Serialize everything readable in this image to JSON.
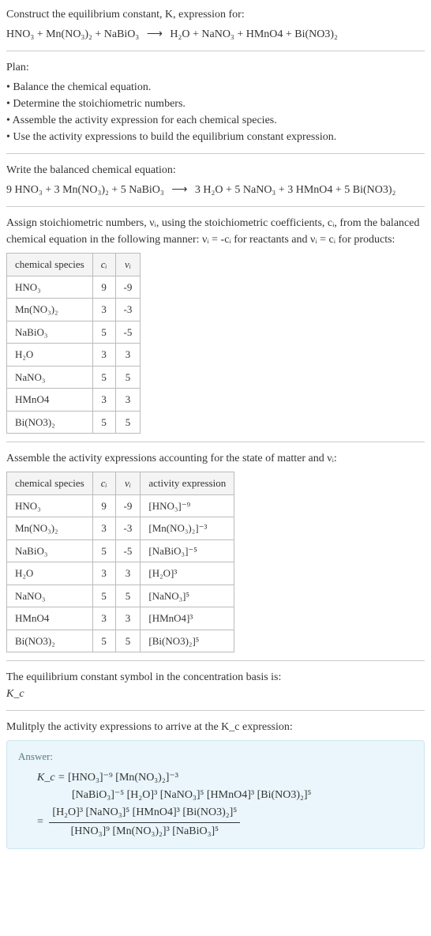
{
  "prompt": {
    "line1": "Construct the equilibrium constant, K, expression for:",
    "equation_lhs": "HNO₃ + Mn(NO₃)₂ + NaBiO₃",
    "arrow": "⟶",
    "equation_rhs": "H₂O + NaNO₃ + HMnO4 + Bi(NO3)₂"
  },
  "plan": {
    "header": "Plan:",
    "items": [
      "Balance the chemical equation.",
      "Determine the stoichiometric numbers.",
      "Assemble the activity expression for each chemical species.",
      "Use the activity expressions to build the equilibrium constant expression."
    ]
  },
  "balanced": {
    "header": "Write the balanced chemical equation:",
    "lhs": "9 HNO₃ + 3 Mn(NO₃)₂ + 5 NaBiO₃",
    "arrow": "⟶",
    "rhs": "3 H₂O + 5 NaNO₃ + 3 HMnO4 + 5 Bi(NO3)₂"
  },
  "stoich_text": "Assign stoichiometric numbers, νᵢ, using the stoichiometric coefficients, cᵢ, from the balanced chemical equation in the following manner: νᵢ = -cᵢ for reactants and νᵢ = cᵢ for products:",
  "table1": {
    "headers": [
      "chemical species",
      "cᵢ",
      "νᵢ"
    ],
    "rows": [
      [
        "HNO₃",
        "9",
        "-9"
      ],
      [
        "Mn(NO₃)₂",
        "3",
        "-3"
      ],
      [
        "NaBiO₃",
        "5",
        "-5"
      ],
      [
        "H₂O",
        "3",
        "3"
      ],
      [
        "NaNO₃",
        "5",
        "5"
      ],
      [
        "HMnO4",
        "3",
        "3"
      ],
      [
        "Bi(NO3)₂",
        "5",
        "5"
      ]
    ]
  },
  "activity_text": "Assemble the activity expressions accounting for the state of matter and νᵢ:",
  "table2": {
    "headers": [
      "chemical species",
      "cᵢ",
      "νᵢ",
      "activity expression"
    ],
    "rows": [
      [
        "HNO₃",
        "9",
        "-9",
        "[HNO₃]⁻⁹"
      ],
      [
        "Mn(NO₃)₂",
        "3",
        "-3",
        "[Mn(NO₃)₂]⁻³"
      ],
      [
        "NaBiO₃",
        "5",
        "-5",
        "[NaBiO₃]⁻⁵"
      ],
      [
        "H₂O",
        "3",
        "3",
        "[H₂O]³"
      ],
      [
        "NaNO₃",
        "5",
        "5",
        "[NaNO₃]⁵"
      ],
      [
        "HMnO4",
        "3",
        "3",
        "[HMnO4]³"
      ],
      [
        "Bi(NO3)₂",
        "5",
        "5",
        "[Bi(NO3)₂]⁵"
      ]
    ]
  },
  "eq_symbol": {
    "line1": "The equilibrium constant symbol in the concentration basis is:",
    "line2": "K_c"
  },
  "multiply_text": "Mulitply the activity expressions to arrive at the K_c expression:",
  "answer": {
    "label": "Answer:",
    "line1_left": "K_c = ",
    "line1_right": "[HNO₃]⁻⁹ [Mn(NO₃)₂]⁻³",
    "line2": "[NaBiO₃]⁻⁵ [H₂O]³ [NaNO₃]⁵ [HMnO4]³ [Bi(NO3)₂]⁵",
    "frac_num": "[H₂O]³ [NaNO₃]⁵ [HMnO4]³ [Bi(NO3)₂]⁵",
    "frac_den": "[HNO₃]⁹ [Mn(NO₃)₂]³ [NaBiO₃]⁵",
    "equals": " = "
  },
  "chart_data": {
    "type": "table",
    "tables": [
      {
        "title": "Stoichiometric numbers",
        "columns": [
          "chemical species",
          "c_i",
          "ν_i"
        ],
        "rows": [
          {
            "species": "HNO3",
            "c_i": 9,
            "nu_i": -9
          },
          {
            "species": "Mn(NO3)2",
            "c_i": 3,
            "nu_i": -3
          },
          {
            "species": "NaBiO3",
            "c_i": 5,
            "nu_i": -5
          },
          {
            "species": "H2O",
            "c_i": 3,
            "nu_i": 3
          },
          {
            "species": "NaNO3",
            "c_i": 5,
            "nu_i": 5
          },
          {
            "species": "HMnO4",
            "c_i": 3,
            "nu_i": 3
          },
          {
            "species": "Bi(NO3)2",
            "c_i": 5,
            "nu_i": 5
          }
        ]
      },
      {
        "title": "Activity expressions",
        "columns": [
          "chemical species",
          "c_i",
          "ν_i",
          "activity expression"
        ],
        "rows": [
          {
            "species": "HNO3",
            "c_i": 9,
            "nu_i": -9,
            "activity": "[HNO3]^-9"
          },
          {
            "species": "Mn(NO3)2",
            "c_i": 3,
            "nu_i": -3,
            "activity": "[Mn(NO3)2]^-3"
          },
          {
            "species": "NaBiO3",
            "c_i": 5,
            "nu_i": -5,
            "activity": "[NaBiO3]^-5"
          },
          {
            "species": "H2O",
            "c_i": 3,
            "nu_i": 3,
            "activity": "[H2O]^3"
          },
          {
            "species": "NaNO3",
            "c_i": 5,
            "nu_i": 5,
            "activity": "[NaNO3]^5"
          },
          {
            "species": "HMnO4",
            "c_i": 3,
            "nu_i": 3,
            "activity": "[HMnO4]^3"
          },
          {
            "species": "Bi(NO3)2",
            "c_i": 5,
            "nu_i": 5,
            "activity": "[Bi(NO3)2]^5"
          }
        ]
      }
    ]
  }
}
